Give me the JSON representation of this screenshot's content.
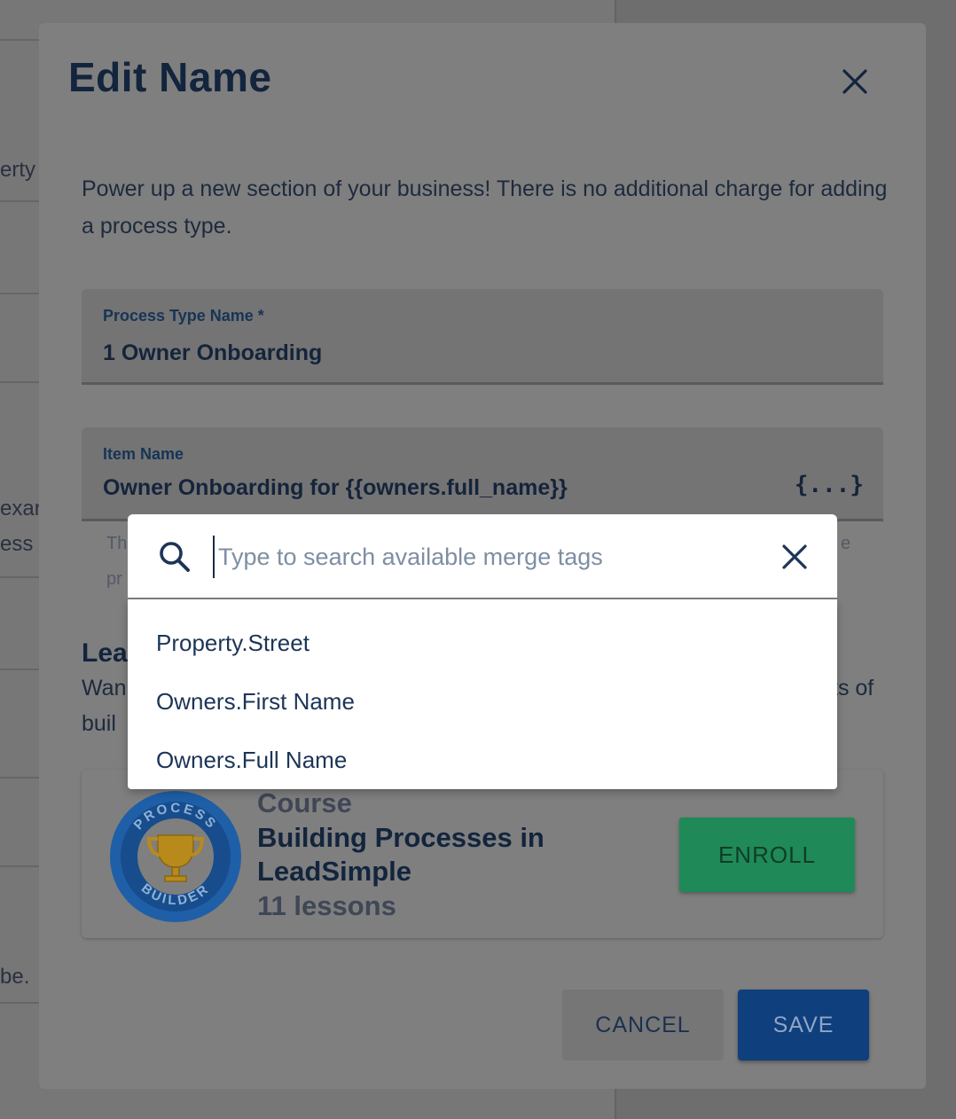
{
  "background": {
    "fragments": [
      "erty",
      "exar",
      "ess",
      "be."
    ]
  },
  "modal": {
    "title": "Edit Name",
    "description": "Power up a new section of your business! There is no additional charge for adding a process type.",
    "process_type_field": {
      "label": "Process Type Name *",
      "value": "1 Owner Onboarding"
    },
    "item_name_field": {
      "label": "Item Name",
      "value": "Owner Onboarding for {{owners.full_name}}",
      "merge_icon": "{...}"
    },
    "hint_fragments": {
      "left_top": "Th",
      "left_bottom": "pr",
      "right": "e"
    },
    "learn_section": {
      "heading_fragment": "Lea",
      "line1_start": "Wan",
      "line1_end": "ts of",
      "line2_start": "buil"
    },
    "course": {
      "kicker": "Course",
      "title": "Building Processes in LeadSimple",
      "lessons": "11 lessons",
      "badge_top_text": "PROCESS",
      "badge_bottom_text": "BUILDER",
      "enroll_label": "ENROLL"
    },
    "cancel_label": "CANCEL",
    "save_label": "SAVE"
  },
  "merge_tag_popup": {
    "search_placeholder": "Type to search available merge tags",
    "items": [
      {
        "label": "Property.Street"
      },
      {
        "label": "Owners.First Name"
      },
      {
        "label": "Owners.Full Name"
      }
    ]
  },
  "colors": {
    "overlay": "#6f6f6f",
    "primary": "#0f3f7c",
    "enroll_green": "#1f8a57",
    "badge_blue": "#1e5fa8",
    "trophy_gold": "#d9a520"
  },
  "icons": {
    "modal_close": "close-icon",
    "popup_search": "search-icon",
    "popup_close": "close-icon",
    "merge": "merge-tag-icon",
    "badge": "trophy-icon"
  }
}
